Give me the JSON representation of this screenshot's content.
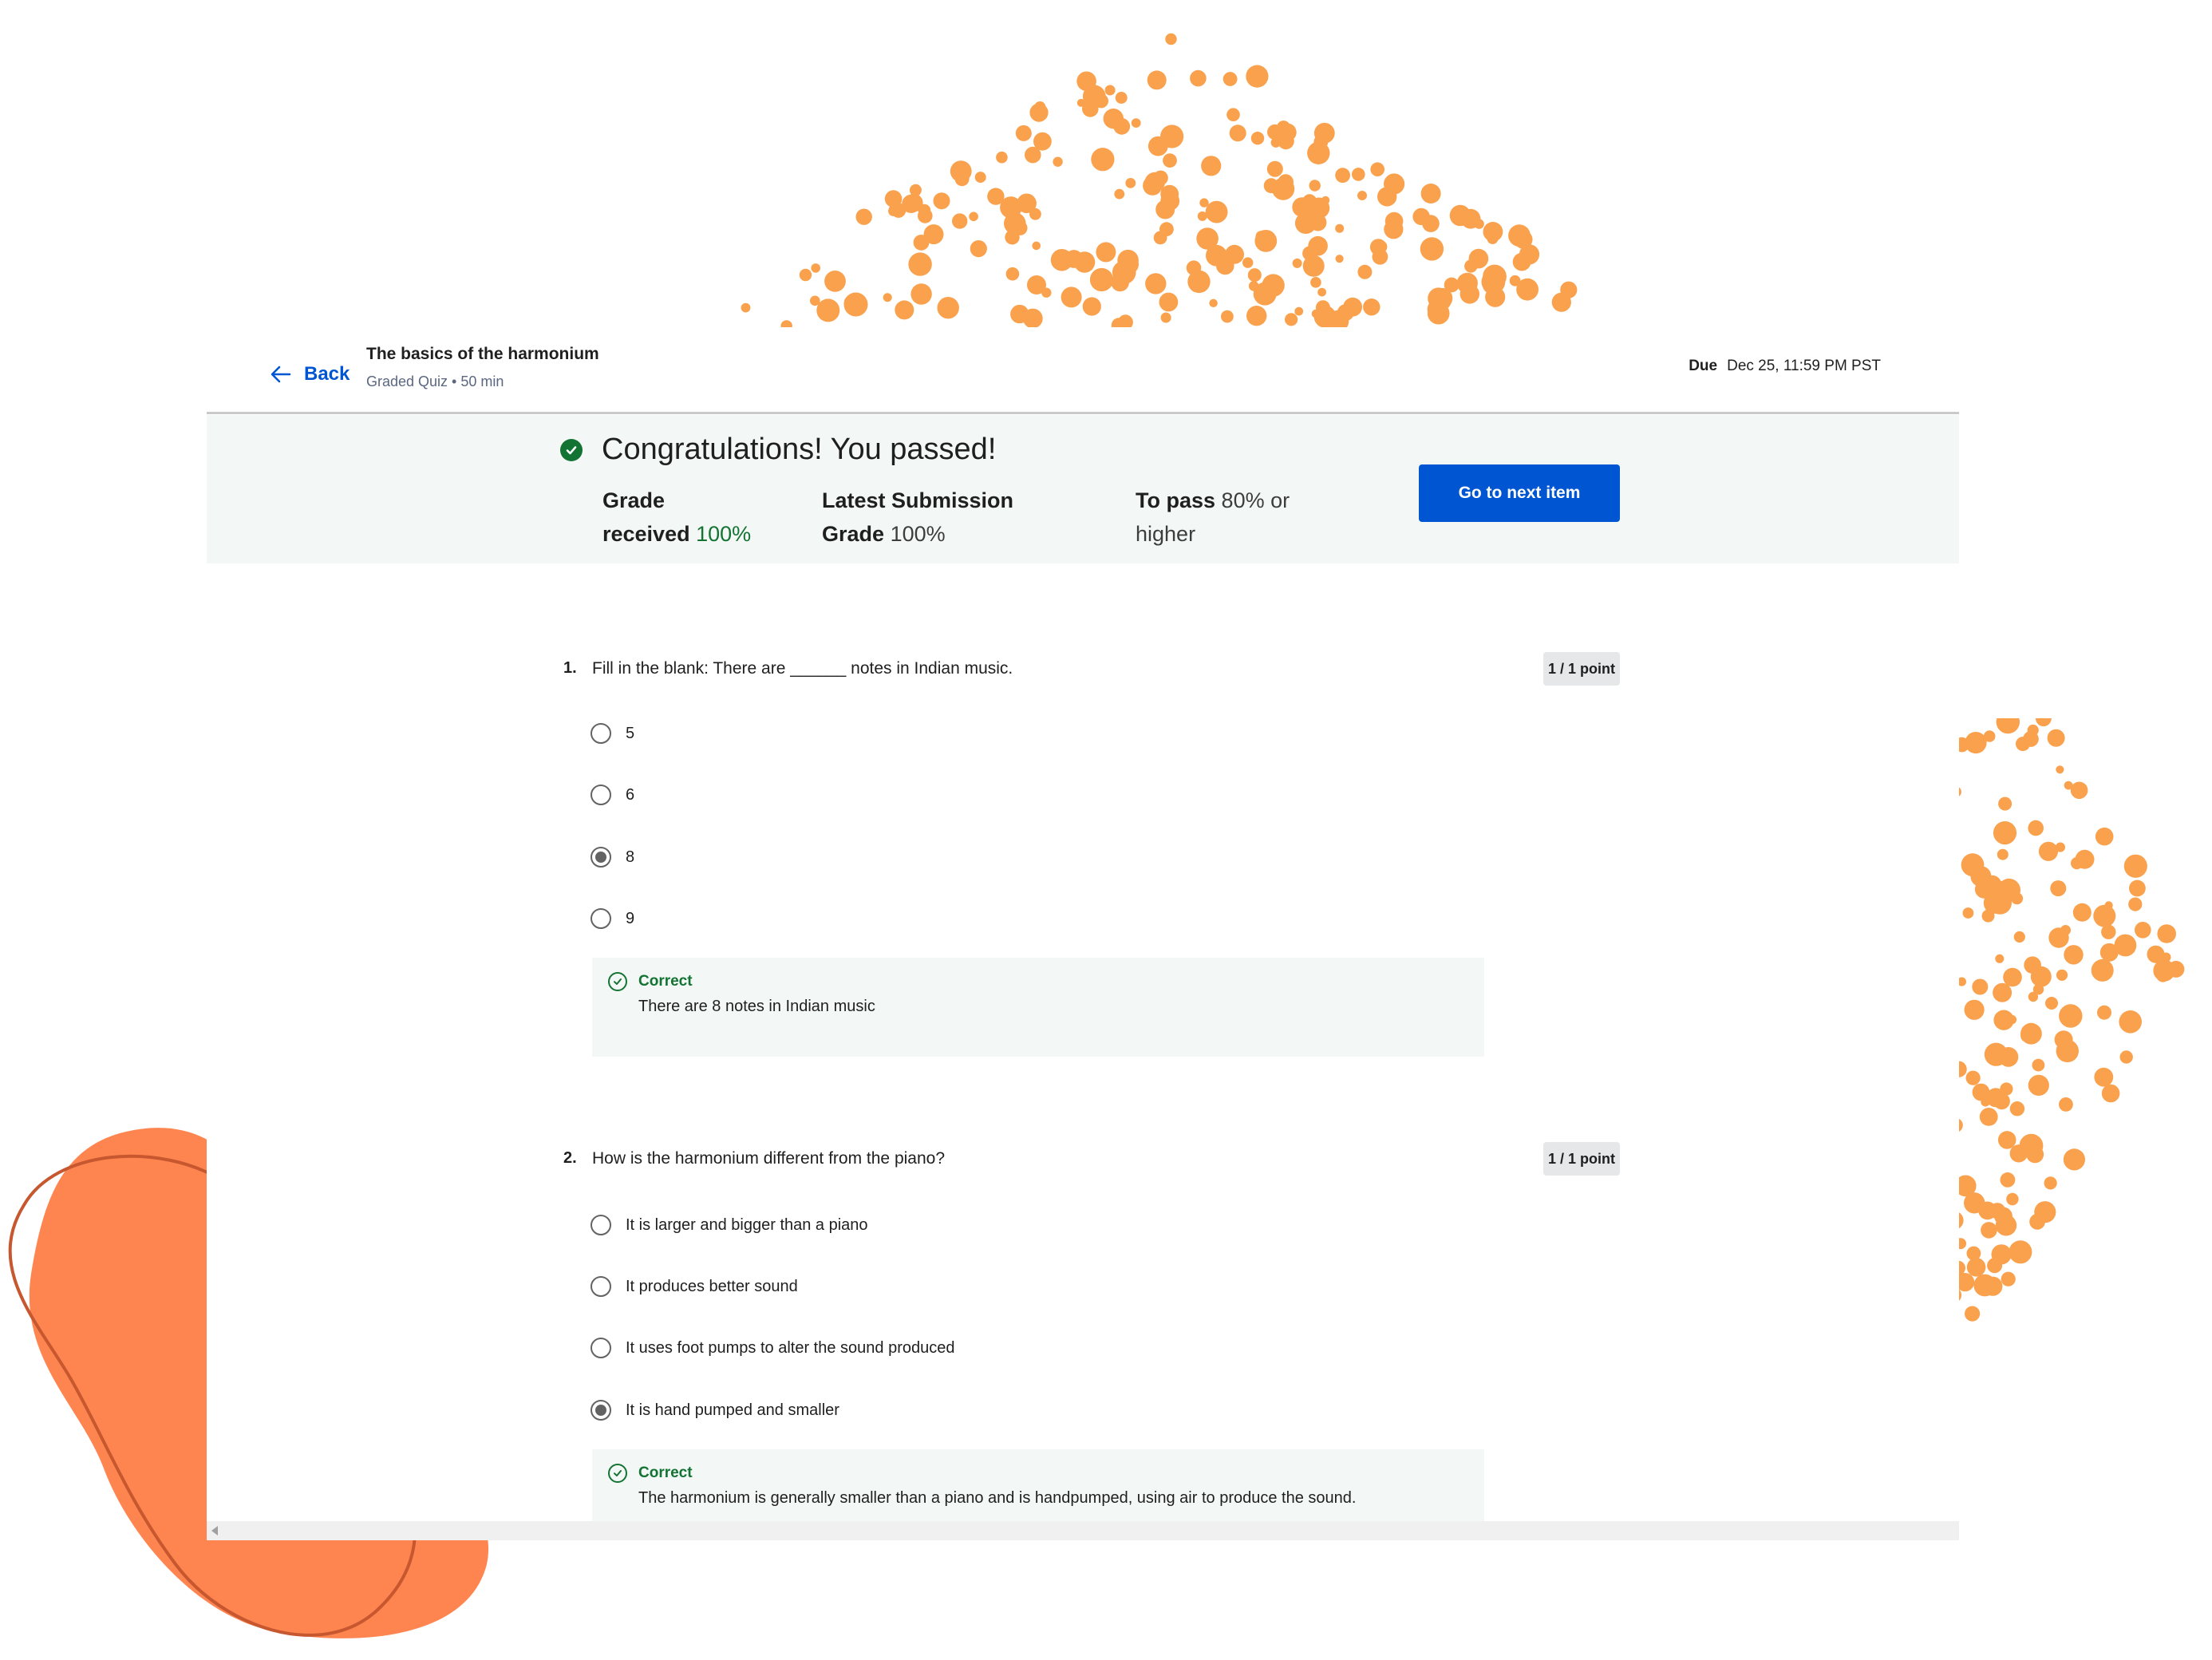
{
  "header": {
    "back_label": "Back",
    "course_title": "The basics of the harmonium",
    "course_subtitle": "Graded Quiz • 50 min",
    "due_label": "Due",
    "due_value": "Dec 25, 11:59 PM PST"
  },
  "result": {
    "title": "Congratulations! You passed!",
    "grade_received_label_1": "Grade",
    "grade_received_label_2": "received",
    "grade_received_value": "100%",
    "latest_label_1": "Latest Submission",
    "latest_label_2": "Grade",
    "latest_value": "100%",
    "to_pass_label": "To pass",
    "to_pass_value": "80% or",
    "to_pass_suffix": "higher",
    "next_button": "Go to next item"
  },
  "questions": [
    {
      "number": "1.",
      "text": "Fill in the blank: There are ______ notes in Indian music.",
      "points": "1 / 1 point",
      "options": [
        {
          "label": "5",
          "selected": false
        },
        {
          "label": "6",
          "selected": false
        },
        {
          "label": "8",
          "selected": true
        },
        {
          "label": "9",
          "selected": false
        }
      ],
      "feedback_title": "Correct",
      "feedback_text": "There are 8 notes in Indian music"
    },
    {
      "number": "2.",
      "text": "How is the harmonium different from the piano?",
      "points": "1 / 1 point",
      "options": [
        {
          "label": "It is larger and bigger than a piano",
          "selected": false
        },
        {
          "label": "It produces better sound",
          "selected": false
        },
        {
          "label": "It uses foot pumps to alter the sound produced",
          "selected": false
        },
        {
          "label": "It is hand pumped and smaller",
          "selected": true
        }
      ],
      "feedback_title": "Correct",
      "feedback_text": "The harmonium is generally smaller than a piano and is handpumped, using air to produce the sound."
    }
  ],
  "colors": {
    "accent": "#0056d2",
    "success": "#137333",
    "decoration": "#f9a14d",
    "blob": "#ff8550"
  }
}
